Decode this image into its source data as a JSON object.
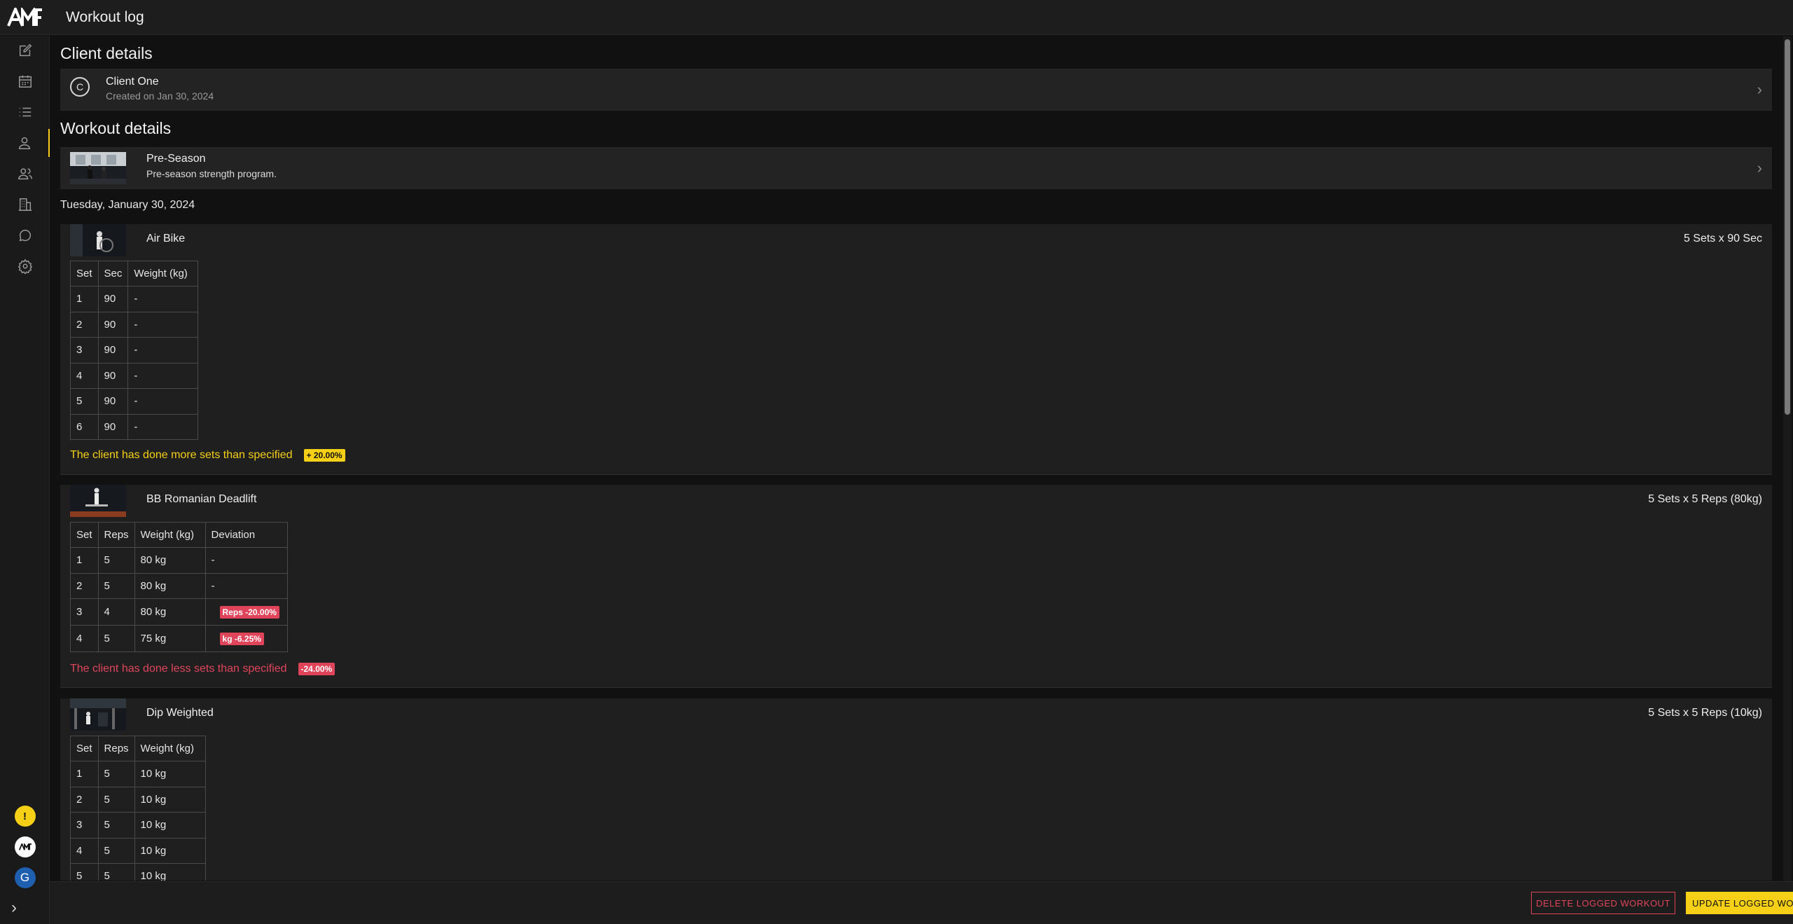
{
  "app": {
    "title": "Workout log",
    "logo": "AMF"
  },
  "sidebar": {
    "items": [
      {
        "icon": "edit-icon"
      },
      {
        "icon": "calendar-icon"
      },
      {
        "icon": "list-icon"
      },
      {
        "icon": "user-icon"
      },
      {
        "icon": "users-icon"
      },
      {
        "icon": "building-icon"
      },
      {
        "icon": "chat-icon"
      },
      {
        "icon": "gear-icon"
      }
    ],
    "active": "user-icon",
    "warning_badge": "!",
    "avatar_initial": "G",
    "expand_icon": "chevron-right-icon"
  },
  "client": {
    "section_title": "Client details",
    "initial": "C",
    "name": "Client One",
    "created": "Created on Jan 30, 2024"
  },
  "workout": {
    "section_title": "Workout details",
    "program_name": "Pre-Season",
    "program_desc": "Pre-season strength program.",
    "date": "Tuesday, January 30, 2024"
  },
  "exercises": [
    {
      "name": "Air Bike",
      "spec": "5 Sets x 90 Sec",
      "headers": [
        "Set",
        "Sec",
        "Weight (kg)"
      ],
      "rows": [
        [
          "1",
          "90",
          "-"
        ],
        [
          "2",
          "90",
          "-"
        ],
        [
          "3",
          "90",
          "-"
        ],
        [
          "4",
          "90",
          "-"
        ],
        [
          "5",
          "90",
          "-"
        ],
        [
          "6",
          "90",
          "-"
        ]
      ],
      "note": "The client has done more sets than specified",
      "note_badge": "+ 20.00%"
    },
    {
      "name": "BB Romanian Deadlift",
      "spec": "5 Sets x 5 Reps (80kg)",
      "headers": [
        "Set",
        "Reps",
        "Weight (kg)",
        "Deviation"
      ],
      "rows": [
        [
          "1",
          "5",
          "80 kg",
          "-"
        ],
        [
          "2",
          "5",
          "80 kg",
          "-"
        ],
        [
          "3",
          "4",
          "80 kg",
          "Reps -20.00%"
        ],
        [
          "4",
          "5",
          "75 kg",
          "kg -6.25%"
        ]
      ],
      "note": "The client has done less sets than specified",
      "note_badge": "-24.00%"
    },
    {
      "name": "Dip Weighted",
      "spec": "5 Sets x 5 Reps (10kg)",
      "headers": [
        "Set",
        "Reps",
        "Weight (kg)"
      ],
      "rows": [
        [
          "1",
          "5",
          "10 kg"
        ],
        [
          "2",
          "5",
          "10 kg"
        ],
        [
          "3",
          "5",
          "10 kg"
        ],
        [
          "4",
          "5",
          "10 kg"
        ],
        [
          "5",
          "5",
          "10 kg"
        ]
      ]
    }
  ],
  "footer": {
    "delete_label": "DELETE LOGGED WORKOUT",
    "update_label": "UPDATE LOGGED WORKOUT"
  },
  "colors": {
    "accent": "#f5d017",
    "danger": "#e0445b",
    "background": "#111111",
    "card": "#232323"
  }
}
